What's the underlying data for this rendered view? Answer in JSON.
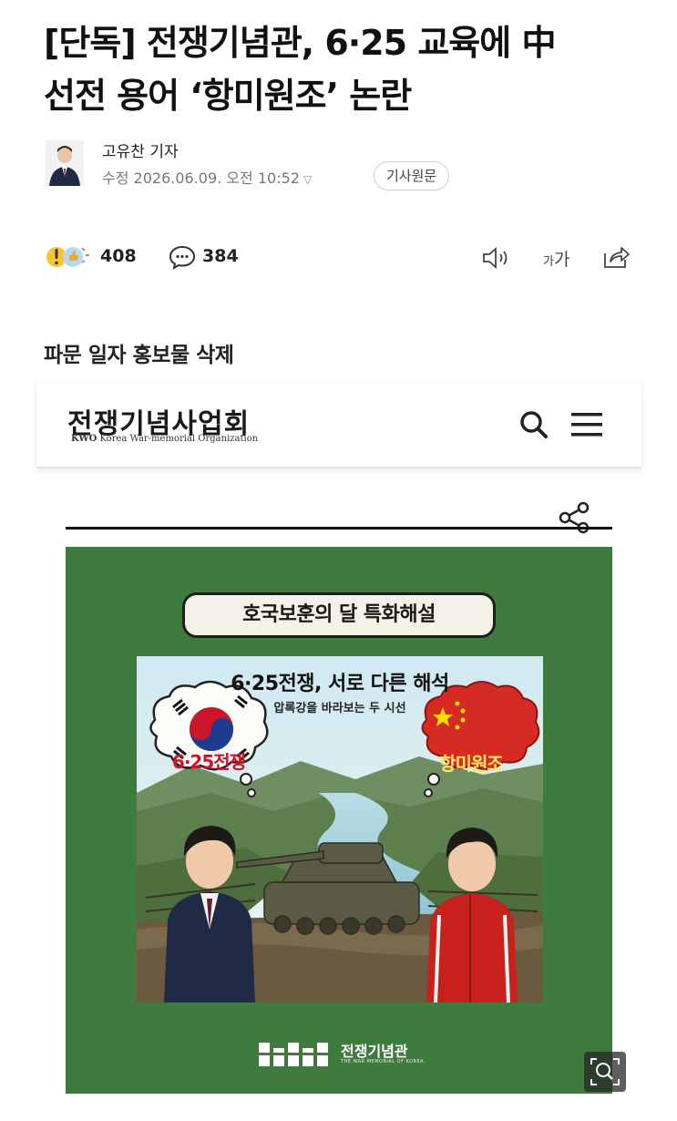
{
  "article": {
    "headline_line1": "[단독] 전쟁기념관, 6·25 교육에 中",
    "headline_line2": "선전 용어 ‘항미원조’ 논란",
    "reporter": "고유찬 기자",
    "meta": "수정 2026.06.09. 오전 10:52",
    "original_button": "기사원문",
    "subhead": "파문 일자 홍보물 삭제"
  },
  "actions": {
    "reaction_count": "408",
    "comment_count": "384",
    "font_size_label_small": "가",
    "font_size_label_large": "가"
  },
  "embed": {
    "site_logo": "전쟁기념사업회",
    "site_sub_bold": "KWO",
    "site_sub_rest": "Korea War-memorial Organization",
    "poster": {
      "pill_text": "호국보훈의 달 특화해설",
      "title": "6·25전쟁, 서로 다른 해석",
      "subtitle": "압록강을 바라보는 두 시선",
      "bubble_left": "6·25전쟁",
      "bubble_right": "항미원조",
      "logo_text": "전쟁기념관",
      "logo_sub": "THE WAR MEMORIAL OF KOREA"
    }
  },
  "colors": {
    "poster_bg": "#3f7a3e",
    "bubble_left_text": "#c9162b",
    "bubble_right_bg": "#d62b22"
  },
  "icons": [
    "avatar",
    "reaction-icon",
    "comment-icon",
    "speaker-icon",
    "share-icon",
    "search-icon",
    "menu-icon",
    "zoom-icon"
  ]
}
